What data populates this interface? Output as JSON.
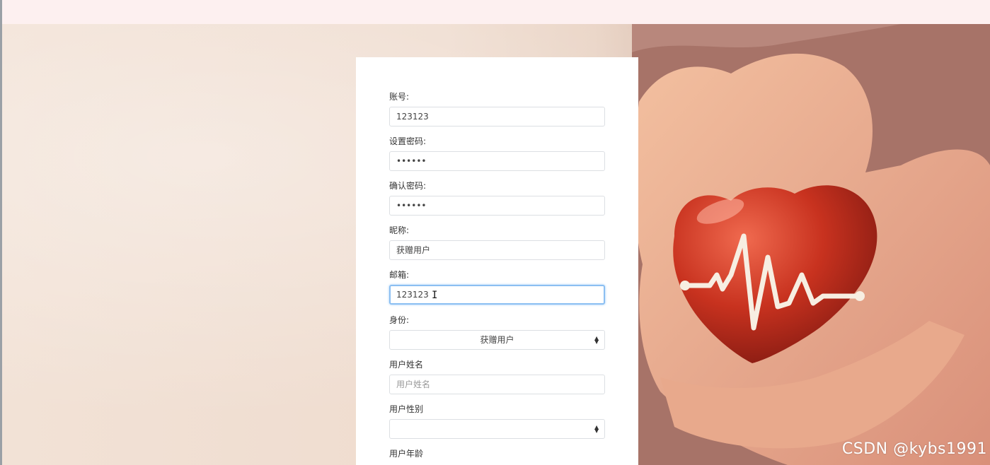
{
  "form": {
    "account": {
      "label": "账号:",
      "value": "123123"
    },
    "password": {
      "label": "设置密码:",
      "value": "••••••"
    },
    "confirm_password": {
      "label": "确认密码:",
      "value": "••••••"
    },
    "nickname": {
      "label": "昵称:",
      "value": "获赠用户"
    },
    "email": {
      "label": "邮箱:",
      "value": "123123"
    },
    "identity": {
      "label": "身份:",
      "selected": "获赠用户"
    },
    "real_name": {
      "label": "用户姓名",
      "placeholder": "用户姓名"
    },
    "gender": {
      "label": "用户性别",
      "selected": ""
    },
    "age": {
      "label": "用户年龄"
    }
  },
  "watermark": "CSDN @kybs1991",
  "colors": {
    "focus_border": "#8cbff2",
    "heart": "#c8321f",
    "topbar": "#fdf0f0"
  },
  "icons": {
    "select_caret": "up-down-caret-icon",
    "text_cursor": "i-beam-cursor-icon"
  }
}
